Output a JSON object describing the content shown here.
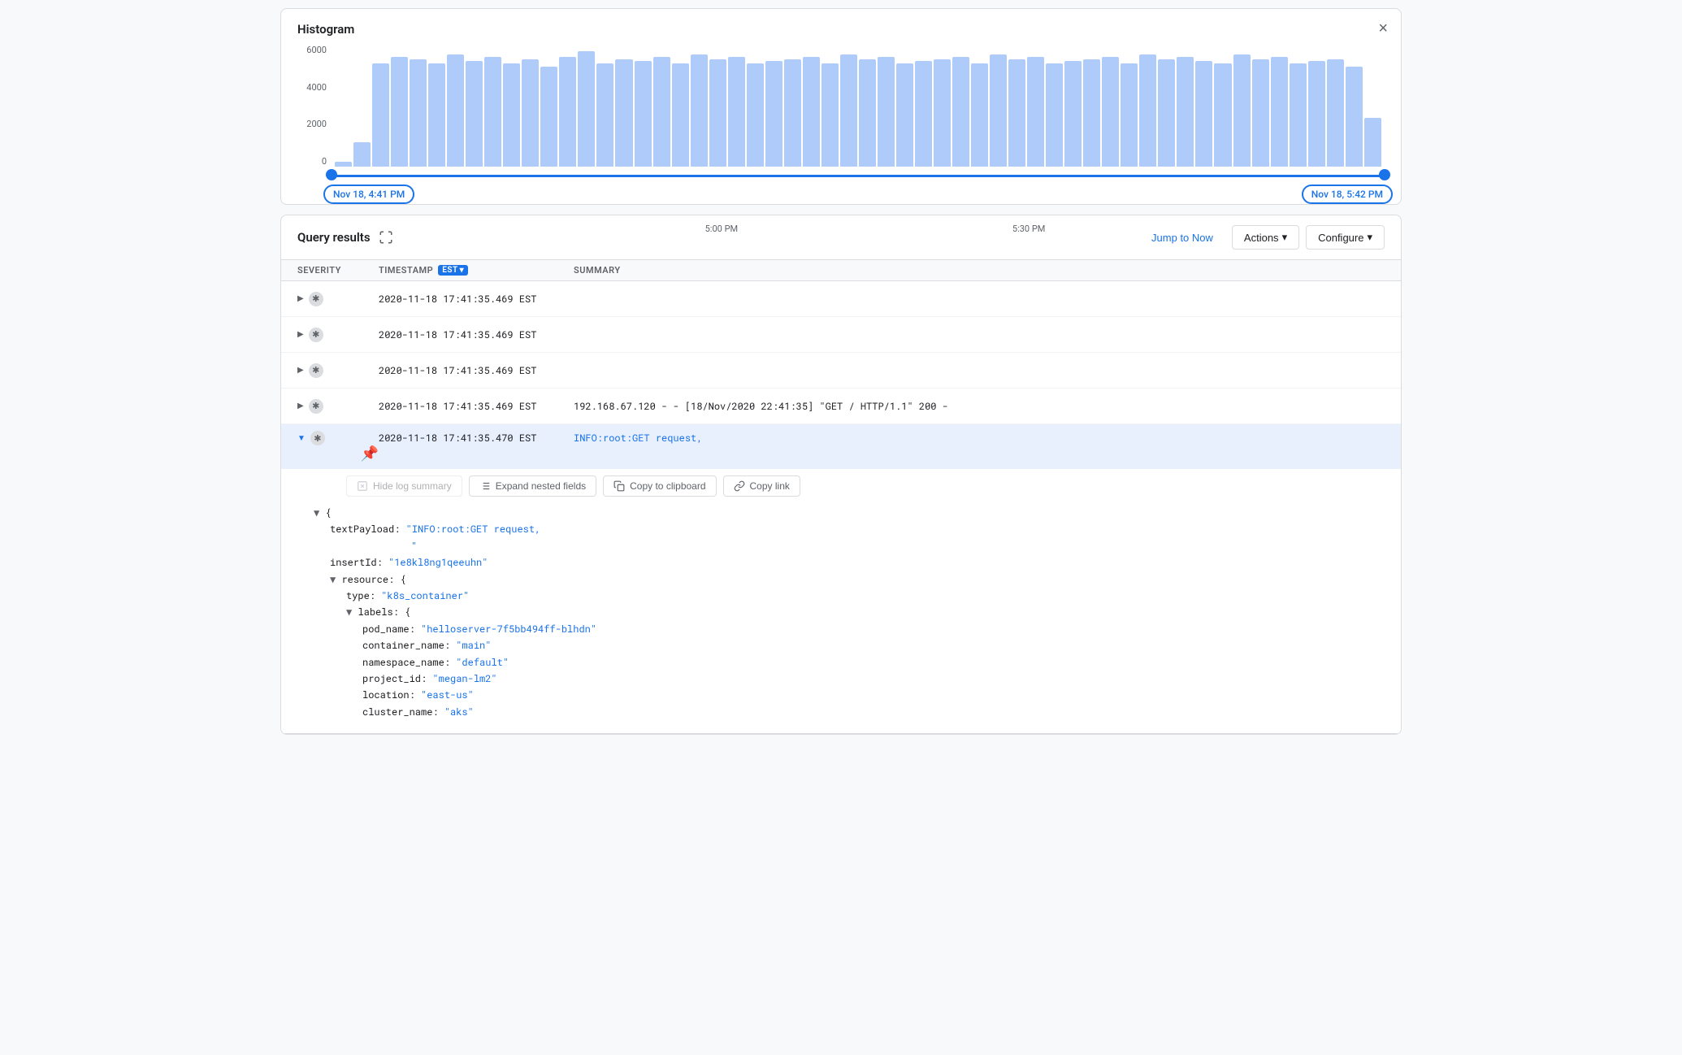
{
  "histogram": {
    "title": "Histogram",
    "close_label": "×",
    "y_labels": [
      "6000",
      "4000",
      "2000",
      "0"
    ],
    "time_labels": [
      "Nov 18, 4:41 PM",
      "5:00 PM",
      "5:30 PM",
      "Nov 18, 5:42 PM"
    ],
    "range_start": "Nov 18, 4:41 PM",
    "range_end": "Nov 18, 5:42 PM"
  },
  "query_results": {
    "title": "Query results",
    "jump_to_now_label": "Jump to Now",
    "actions_label": "Actions",
    "configure_label": "Configure",
    "columns": {
      "severity": "SEVERITY",
      "timestamp": "TIMESTAMP",
      "tz": "EST",
      "summary": "SUMMARY"
    },
    "rows": [
      {
        "id": 1,
        "timestamp": "2020-11-18 17:41:35.469 EST",
        "summary": "",
        "expanded": false
      },
      {
        "id": 2,
        "timestamp": "2020-11-18 17:41:35.469 EST",
        "summary": "",
        "expanded": false
      },
      {
        "id": 3,
        "timestamp": "2020-11-18 17:41:35.469 EST",
        "summary": "",
        "expanded": false
      },
      {
        "id": 4,
        "timestamp": "2020-11-18 17:41:35.469 EST",
        "summary": "192.168.67.120 - - [18/Nov/2020 22:41:35] \"GET / HTTP/1.1\" 200 -",
        "expanded": false
      },
      {
        "id": 5,
        "timestamp": "2020-11-18 17:41:35.470 EST",
        "summary": "INFO:root:GET request,",
        "expanded": true
      }
    ],
    "expanded_row": {
      "hide_log_summary": "Hide log summary",
      "expand_nested": "Expand nested fields",
      "copy_to_clipboard": "Copy to clipboard",
      "copy_link": "Copy link",
      "json": {
        "text_payload_key": "textPayload:",
        "text_payload_value": "\"INFO:root:GET request,",
        "text_payload_value2": "\"",
        "insert_id_key": "insertId:",
        "insert_id_value": "\"1e8kl8ng1qeeuhn\"",
        "resource_key": "resource:",
        "type_key": "type:",
        "type_value": "\"k8s_container\"",
        "labels_key": "labels:",
        "pod_name_key": "pod_name:",
        "pod_name_value": "\"helloserver-7f5bb494ff-blhdn\"",
        "container_name_key": "container_name:",
        "container_name_value": "\"main\"",
        "namespace_name_key": "namespace_name:",
        "namespace_name_value": "\"default\"",
        "project_id_key": "project_id:",
        "project_id_value": "\"megan-lm2\"",
        "location_key": "location:",
        "location_value": "\"east-us\"",
        "cluster_name_key": "cluster_name:",
        "cluster_name_value": "\"aks\""
      }
    }
  }
}
